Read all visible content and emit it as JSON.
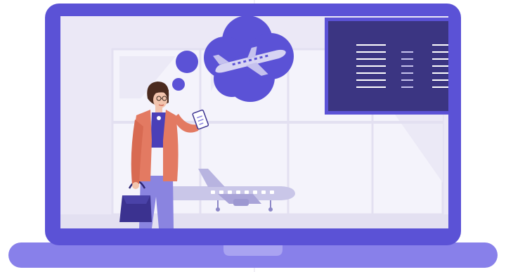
{
  "illustration": {
    "subject": "traveler-at-airport",
    "colors": {
      "laptop_frame": "#5b52d6",
      "laptop_base": "#8880ea",
      "screen_bg": "#ebe8f6",
      "window_glass": "#f4f3fb",
      "board_bg": "#3b3582",
      "cloud": "#5b52d6",
      "jacket": "#e37a62",
      "pants": "#8a84e0",
      "top": "#4a3fb8",
      "hair": "#4a2a1e",
      "skin": "#f2c4ad",
      "bag": "#3b3290",
      "plane_body": "#c9c6e8"
    },
    "icons": [
      "airplane-icon",
      "thought-cloud-icon",
      "departure-board-icon",
      "phone-icon",
      "handbag-icon"
    ]
  }
}
